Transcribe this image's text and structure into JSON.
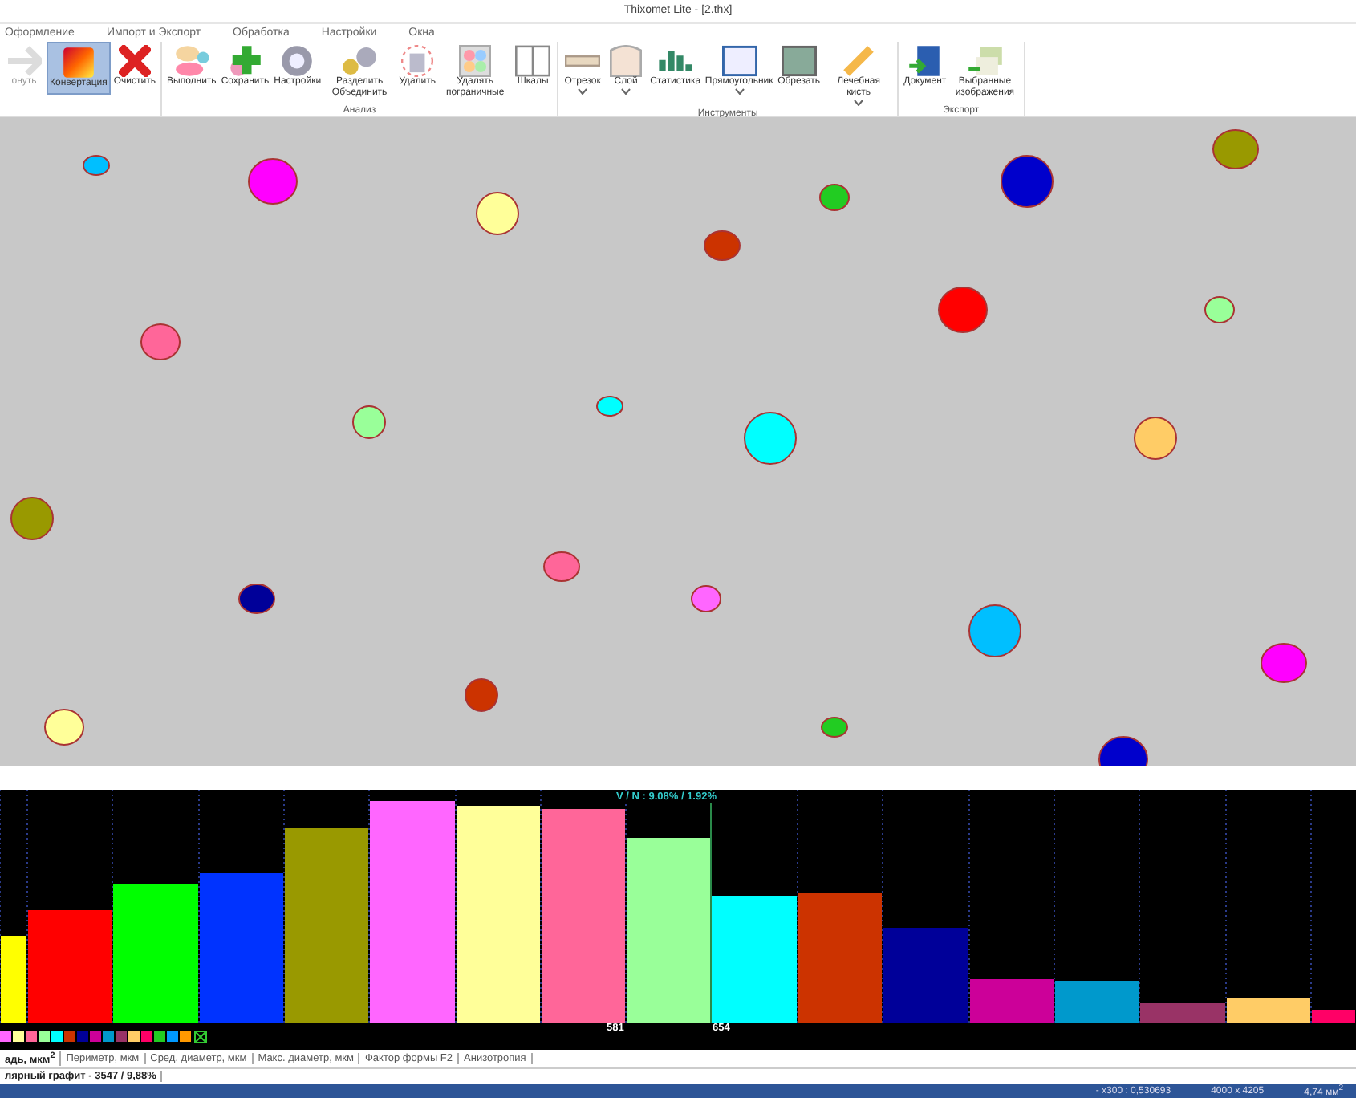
{
  "window": {
    "title": "Thixomet Lite - [2.thx]"
  },
  "menu": [
    {
      "label": "Оформление"
    },
    {
      "label": "Импорт и Экспорт"
    },
    {
      "label": "Обработка"
    },
    {
      "label": "Настройки"
    },
    {
      "label": "Окна"
    }
  ],
  "ribbon": [
    {
      "buttons": [
        {
          "label": "онуть",
          "selected": false,
          "disabled": true,
          "dropdown": false
        },
        {
          "label": "Конвертация",
          "selected": true,
          "disabled": false,
          "dropdown": false
        },
        {
          "label": "Очистить",
          "selected": false,
          "disabled": false,
          "dropdown": false
        }
      ]
    },
    {
      "label": "Анализ",
      "buttons": [
        {
          "label": "Выполнить",
          "selected": false,
          "disabled": false,
          "dropdown": false
        },
        {
          "label": "Сохранить",
          "selected": false,
          "disabled": false,
          "dropdown": false
        },
        {
          "label": "Настройки",
          "selected": false,
          "disabled": false,
          "dropdown": false
        },
        {
          "label": "Разделить Объединить",
          "selected": false,
          "disabled": false,
          "dropdown": false
        },
        {
          "label": "Удалить",
          "selected": false,
          "disabled": false,
          "dropdown": false
        },
        {
          "label": "Удалять пограничные",
          "selected": false,
          "disabled": false,
          "dropdown": false
        },
        {
          "label": "Шкалы",
          "selected": false,
          "disabled": false,
          "dropdown": false
        }
      ]
    },
    {
      "label": "Инструменты",
      "buttons": [
        {
          "label": "Отрезок",
          "selected": false,
          "disabled": false,
          "dropdown": true
        },
        {
          "label": "Слой",
          "selected": false,
          "disabled": false,
          "dropdown": true
        },
        {
          "label": "Статистика",
          "selected": false,
          "disabled": false,
          "dropdown": false
        },
        {
          "label": "Прямоугольник",
          "selected": false,
          "disabled": false,
          "dropdown": true
        },
        {
          "label": "Обрезать",
          "selected": false,
          "disabled": false,
          "dropdown": false
        },
        {
          "label": "Лечебная кисть",
          "selected": false,
          "disabled": false,
          "dropdown": true
        }
      ]
    },
    {
      "label": "Экспорт",
      "buttons": [
        {
          "label": "Документ",
          "selected": false,
          "disabled": false,
          "dropdown": false
        },
        {
          "label": "Выбранные изображения",
          "selected": false,
          "disabled": false,
          "dropdown": false
        }
      ]
    }
  ],
  "histogram": {
    "header": "V / N : 9.08% / 1.92%",
    "bar_labels": [
      "581",
      "654"
    ]
  },
  "tabs": [
    {
      "label": "адь, мкм$^{2}$",
      "selected": true
    },
    {
      "label": "Периметр, мкм",
      "selected": false
    },
    {
      "label": "Сред. диаметр, мкм",
      "selected": false
    },
    {
      "label": "Макс. диаметр, мкм",
      "selected": false
    },
    {
      "label": "Фактор формы F2",
      "selected": false
    },
    {
      "label": "Анизотропия",
      "selected": false
    }
  ],
  "info": "лярный графит - 3547 / 9,88%",
  "status_bar": [
    "- x300 : 0,530693",
    "4000 x 4205",
    "4,74 мм$^{2}$"
  ]
}
